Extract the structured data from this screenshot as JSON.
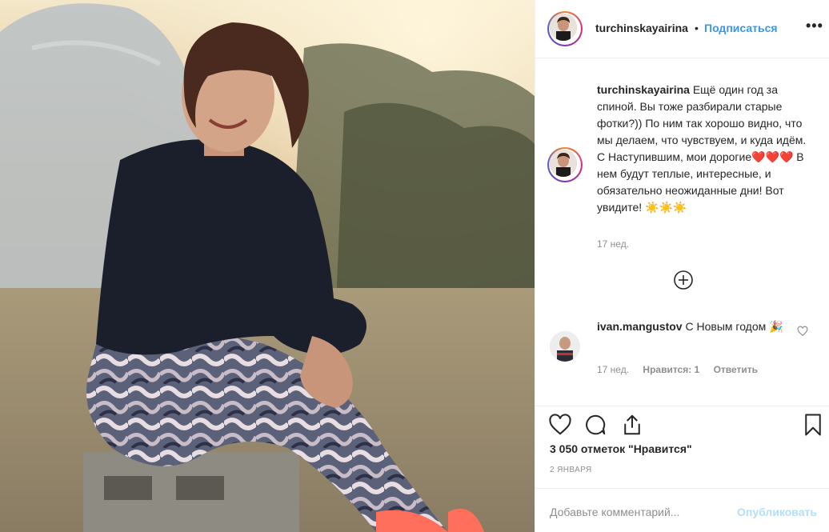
{
  "post": {
    "image_alt": "photo",
    "author": "turchinskayairina",
    "dot": "•",
    "follow_label": "Подписаться",
    "more_glyph": "•••"
  },
  "caption": {
    "username": "turchinskayairina",
    "text": "Ещё один год за спиной. Вы тоже разбирали старые фотки?)) По ним так хорошо видно, что мы делаем, что чувствуем, и куда идём. С Наступившим, мои дорогие❤️❤️❤️ В нем будут теплые, интересные, и обязательно неожиданные дни! Вот увидите! ☀️☀️☀️",
    "time": "17 нед."
  },
  "comment": {
    "username": "ivan.mangustov",
    "text": "С Новым годом 🎉",
    "time": "17 нед.",
    "likes": "Нравится: 1",
    "reply": "Ответить"
  },
  "actions": {
    "likes_count": "3 050 отметок \"Нравится\"",
    "date": "2 ЯНВАРЯ"
  },
  "composer": {
    "placeholder": "Добавьте комментарий...",
    "post_label": "Опубликовать"
  },
  "colors": {
    "accent": "#3897f0",
    "post_disabled": "#b2dffc",
    "muted": "#8e8e8e",
    "text": "#262626"
  }
}
